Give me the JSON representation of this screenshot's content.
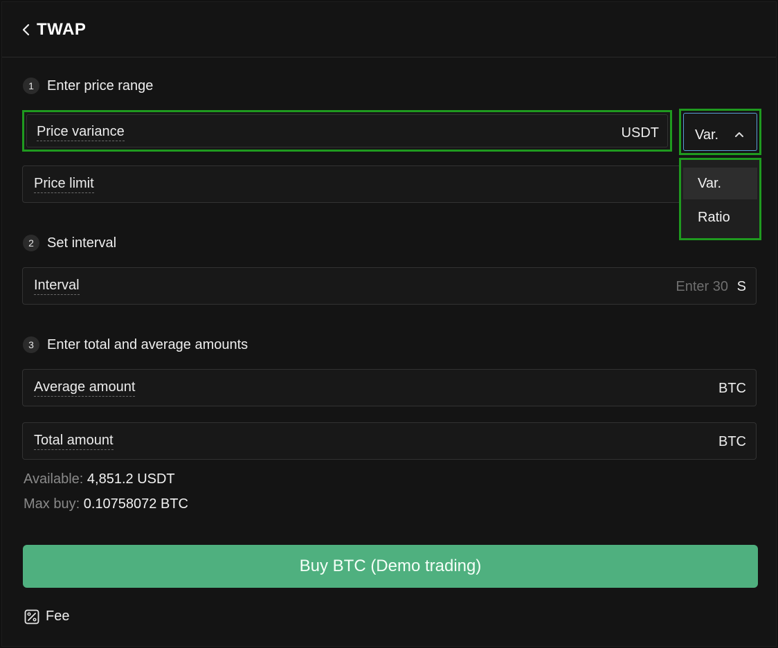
{
  "header": {
    "title": "TWAP"
  },
  "steps": [
    {
      "num": "1",
      "label": "Enter price range"
    },
    {
      "num": "2",
      "label": "Set interval"
    },
    {
      "num": "3",
      "label": "Enter total and average amounts"
    }
  ],
  "fields": {
    "price_variance": {
      "label": "Price variance",
      "unit": "USDT"
    },
    "price_limit": {
      "label": "Price limit"
    },
    "interval": {
      "label": "Interval",
      "placeholder": "Enter 30",
      "unit": "S"
    },
    "average_amount": {
      "label": "Average amount",
      "unit": "BTC"
    },
    "total_amount": {
      "label": "Total amount",
      "unit": "BTC"
    }
  },
  "variance_mode": {
    "selected": "Var.",
    "options": [
      "Var.",
      "Ratio"
    ]
  },
  "balance": {
    "available_label": "Available:",
    "available_value": "4,851.2 USDT",
    "max_buy_label": "Max buy:",
    "max_buy_value": "0.10758072 BTC"
  },
  "buy_button": {
    "label": "Buy BTC (Demo trading)"
  },
  "fee": {
    "label": "Fee"
  },
  "colors": {
    "background": "#141414",
    "accent_green": "#4fb07f",
    "highlight_border": "#1f9a1f"
  }
}
